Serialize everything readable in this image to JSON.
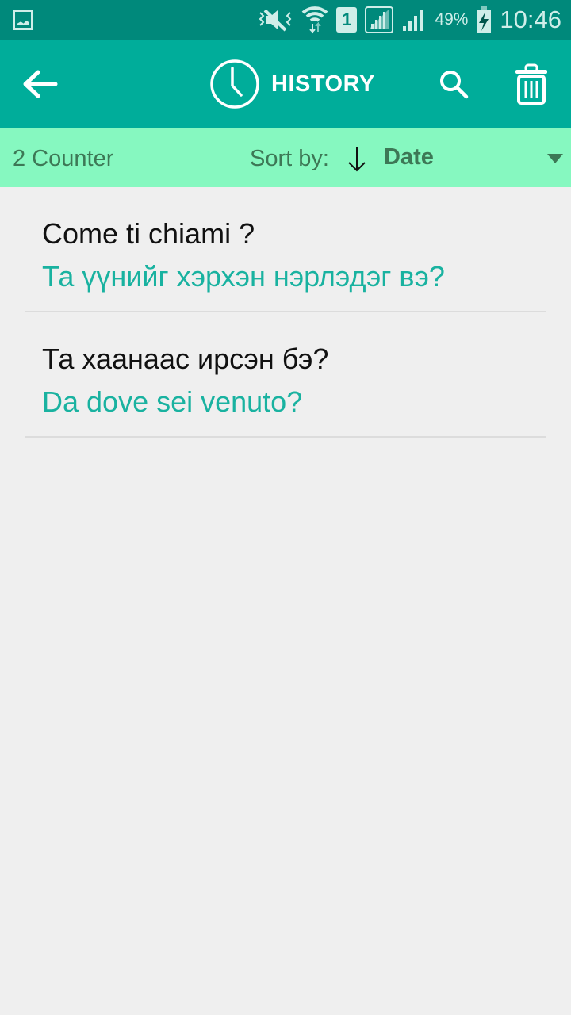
{
  "status_bar": {
    "battery_percent": "49%",
    "time": "10:46",
    "sim_slot": "1",
    "icons": [
      "gallery-icon",
      "mute-icon",
      "wifi-icon",
      "sim-icon",
      "signal-icon",
      "signal-icon-2",
      "battery-charging-icon"
    ]
  },
  "app_bar": {
    "title": "HISTORY",
    "back_icon": "arrow-left-icon",
    "title_icon": "clock-icon",
    "search_icon": "search-icon",
    "delete_icon": "trash-icon"
  },
  "sort_bar": {
    "counter": "2 Counter",
    "sort_label": "Sort by:",
    "sort_direction": "descending",
    "sort_value": "Date"
  },
  "history": [
    {
      "source": "Come ti chiami ?",
      "translation": "Та үүнийг хэрхэн нэрлэдэг вэ?"
    },
    {
      "source": "Та хаанаас ирсэн бэ?",
      "translation": "Da dove sei venuto?"
    }
  ],
  "colors": {
    "status_bar": "#00897b",
    "app_bar": "#00ad9a",
    "sort_bar": "#86f8c0",
    "translation_text": "#19b2a0",
    "background": "#efefef"
  }
}
